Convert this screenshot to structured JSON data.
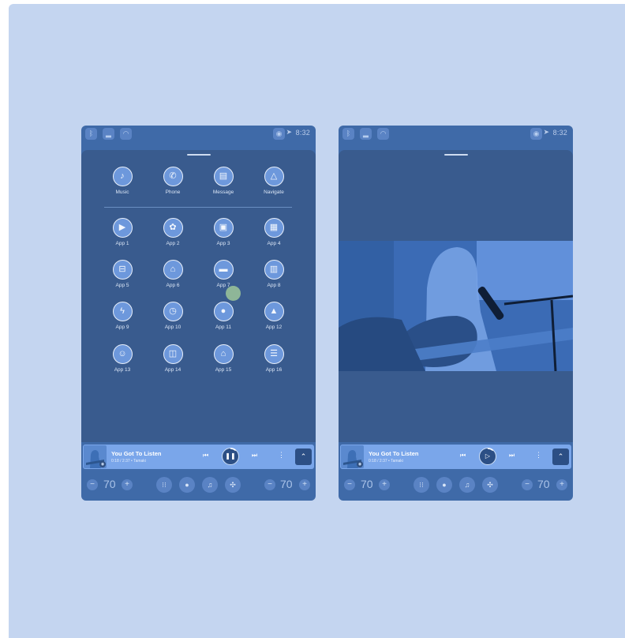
{
  "status": {
    "time": "8:32"
  },
  "launcher": {
    "primary": [
      {
        "label": "Music",
        "icon": "music-note-icon",
        "glyph": "♪"
      },
      {
        "label": "Phone",
        "icon": "phone-icon",
        "glyph": "✆"
      },
      {
        "label": "Message",
        "icon": "message-icon",
        "glyph": "▤"
      },
      {
        "label": "Navigate",
        "icon": "navigation-icon",
        "glyph": "△"
      }
    ],
    "apps": [
      {
        "label": "App 1",
        "icon": "play-icon",
        "glyph": "▶"
      },
      {
        "label": "App 2",
        "icon": "flower-icon",
        "glyph": "✿"
      },
      {
        "label": "App 3",
        "icon": "radio-icon",
        "glyph": "▣"
      },
      {
        "label": "App 4",
        "icon": "calendar-icon",
        "glyph": "▦"
      },
      {
        "label": "App 5",
        "icon": "car-icon",
        "glyph": "⊟"
      },
      {
        "label": "App 6",
        "icon": "store-icon",
        "glyph": "⌂"
      },
      {
        "label": "App 7",
        "icon": "clapper-icon",
        "glyph": "▬"
      },
      {
        "label": "App 8",
        "icon": "document-icon",
        "glyph": "▥"
      },
      {
        "label": "App 9",
        "icon": "bolt-icon",
        "glyph": "ϟ"
      },
      {
        "label": "App 10",
        "icon": "alarm-icon",
        "glyph": "◷"
      },
      {
        "label": "App 11",
        "icon": "mic-icon",
        "glyph": "●"
      },
      {
        "label": "App 12",
        "icon": "navigation-icon",
        "glyph": "▲"
      },
      {
        "label": "App 13",
        "icon": "person-icon",
        "glyph": "☺"
      },
      {
        "label": "App 14",
        "icon": "map-icon",
        "glyph": "◫"
      },
      {
        "label": "App 15",
        "icon": "home-icon",
        "glyph": "⌂"
      },
      {
        "label": "App 16",
        "icon": "list-icon",
        "glyph": "☰"
      }
    ]
  },
  "player": {
    "title": "You Got To Listen",
    "meta": "0:18 / 2:37 • Tamaki",
    "progress": 0.115
  },
  "climate": {
    "left_temp": "70",
    "right_temp": "70"
  },
  "colors": {
    "background": "#c4d5f0",
    "screen": "#3f6aa8",
    "sheet": "#395b8e",
    "player": "#7aa6ea",
    "accent": "#2c4f85"
  }
}
